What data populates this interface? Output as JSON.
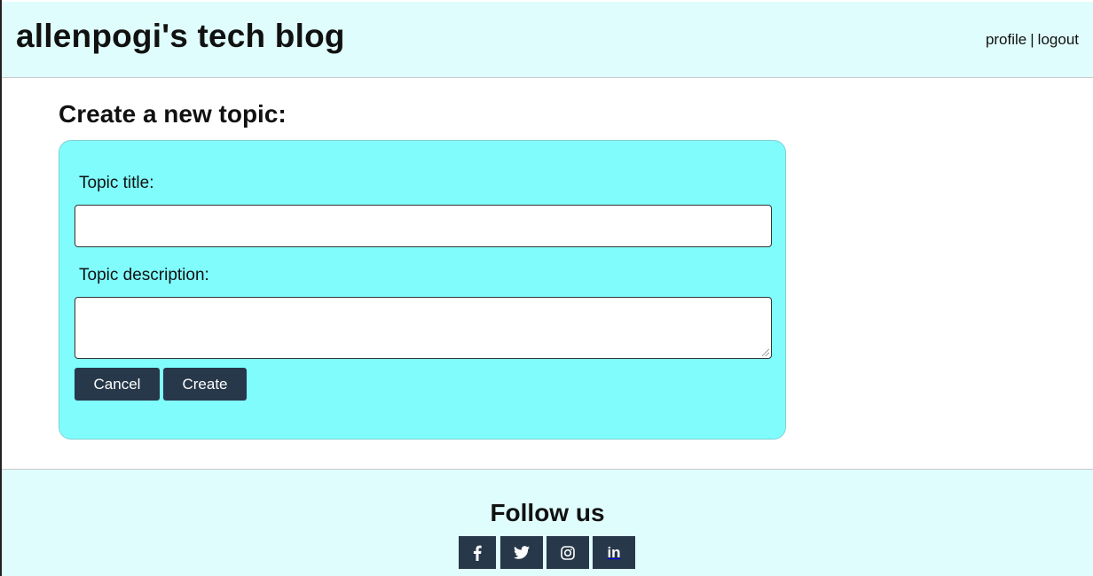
{
  "header": {
    "site_title": "allenpogi's tech blog",
    "nav": {
      "profile": "profile",
      "separator": "|",
      "logout": "logout"
    }
  },
  "main": {
    "heading": "Create a new topic:",
    "form": {
      "title_label": "Topic title:",
      "title_value": "",
      "description_label": "Topic description:",
      "description_value": "",
      "cancel_label": "Cancel",
      "create_label": "Create"
    }
  },
  "footer": {
    "title": "Follow us",
    "social": [
      {
        "icon": "facebook-icon"
      },
      {
        "icon": "twitter-icon"
      },
      {
        "icon": "instagram-icon"
      },
      {
        "icon": "linkedin-icon",
        "text": "in"
      }
    ]
  },
  "colors": {
    "header_bg": "#e0fdfd",
    "form_bg": "#80fcfc",
    "button_bg": "#27384a",
    "text": "#111111"
  }
}
